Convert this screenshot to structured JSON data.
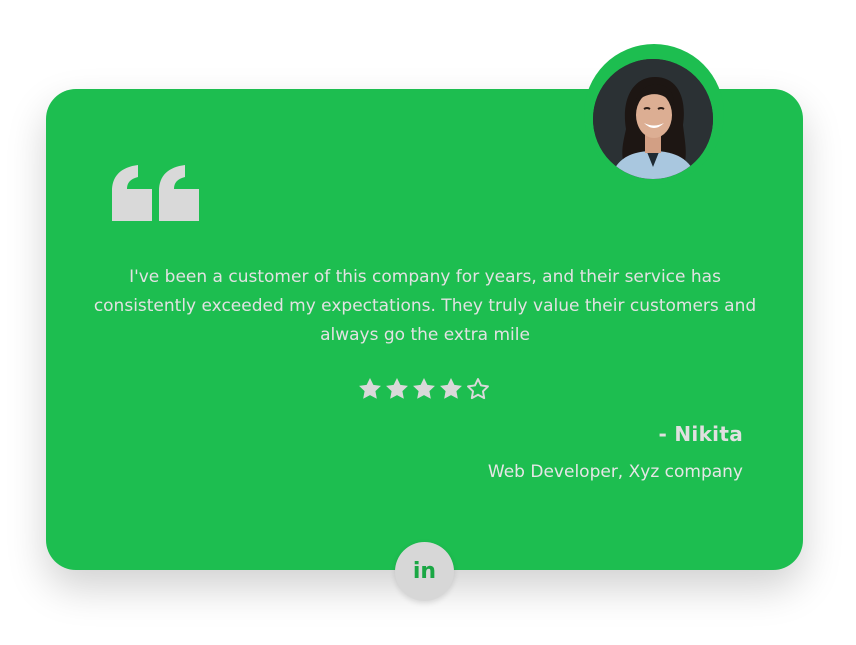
{
  "testimonial": {
    "text": "I've been a customer of this company for years, and their service has consistently exceeded my expectations. They truly value their customers and always go the extra mile",
    "rating": 4,
    "rating_max": 5,
    "author": "- Nikita",
    "role": "Web Developer, Xyz company"
  },
  "social": {
    "linkedin_label": "in"
  },
  "colors": {
    "card": "#1dbe50",
    "text": "#e2e2e2",
    "quote_mark": "#d9d9d9",
    "stars": "#d9d9d9",
    "linkedin_bg": "#d7d7d7",
    "linkedin_text": "#1aa744"
  },
  "icons": {
    "quote": "quote-icon",
    "star": "star-icon",
    "social": "linkedin-icon"
  }
}
